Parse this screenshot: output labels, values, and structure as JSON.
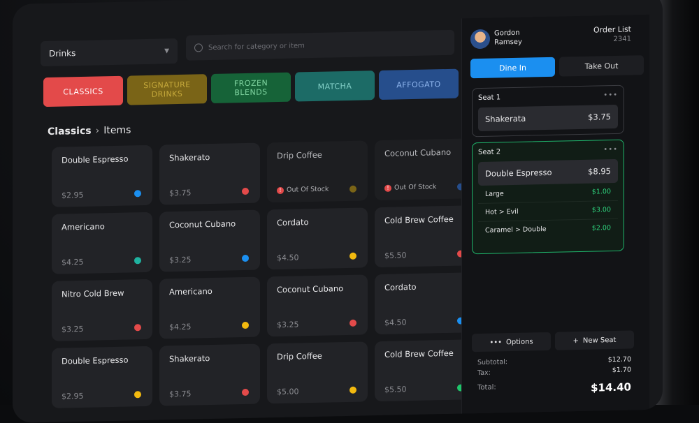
{
  "category_select": {
    "value": "Drinks"
  },
  "search": {
    "placeholder": "Search for category or item"
  },
  "tabs": [
    {
      "label": "CLASSICS"
    },
    {
      "label": "SIGNATURE DRINKS"
    },
    {
      "label": "FROZEN BLENDS"
    },
    {
      "label": "MATCHA"
    },
    {
      "label": "AFFOGATO"
    }
  ],
  "breadcrumb": {
    "current": "Classics",
    "sub": "Items"
  },
  "items": [
    {
      "name": "Double Espresso",
      "price": "$2.95",
      "dot": "#1b8ff0"
    },
    {
      "name": "Shakerato",
      "price": "$3.75",
      "dot": "#e34a4a"
    },
    {
      "name": "Drip Coffee",
      "status": "Out Of Stock",
      "dot": "#7a6417"
    },
    {
      "name": "Coconut Cubano",
      "status": "Out Of Stock",
      "dot": "#264e8c"
    },
    {
      "name": "Americano",
      "price": "$4.25",
      "dot": "#1fb2a0"
    },
    {
      "name": "Coconut Cubano",
      "price": "$3.25",
      "dot": "#1b8ff0"
    },
    {
      "name": "Cordato",
      "price": "$4.50",
      "dot": "#f2b90f"
    },
    {
      "name": "Cold Brew Coffee",
      "price": "$5.50",
      "dot": "#e34a4a"
    },
    {
      "name": "Nitro Cold Brew",
      "price": "$3.25",
      "dot": "#e34a4a"
    },
    {
      "name": "Americano",
      "price": "$4.25",
      "dot": "#f2b90f"
    },
    {
      "name": "Coconut Cubano",
      "price": "$3.25",
      "dot": "#e34a4a"
    },
    {
      "name": "Cordato",
      "price": "$4.50",
      "dot": "#1b8ff0"
    },
    {
      "name": "Double Espresso",
      "price": "$2.95",
      "dot": "#f2b90f"
    },
    {
      "name": "Shakerato",
      "price": "$3.75",
      "dot": "#e34a4a"
    },
    {
      "name": "Drip Coffee",
      "price": "$5.00",
      "dot": "#f2b90f"
    },
    {
      "name": "Cold Brew Coffee",
      "price": "$5.50",
      "dot": "#1fc46a"
    }
  ],
  "user": {
    "first": "Gordon",
    "last": "Ramsey"
  },
  "order": {
    "label": "Order List",
    "number": "2341"
  },
  "service": {
    "dine_in": "Dine In",
    "take_out": "Take Out"
  },
  "seat1": {
    "label": "Seat 1",
    "more": "•••",
    "item": "Shakerata",
    "price": "$3.75"
  },
  "seat2": {
    "label": "Seat 2",
    "more": "•••",
    "item": "Double Espresso",
    "price": "$8.95",
    "mods": [
      {
        "name": "Large",
        "price": "$1.00"
      },
      {
        "name": "Hot > Evil",
        "price": "$3.00"
      },
      {
        "name": "Caramel > Double",
        "price": "$2.00"
      }
    ]
  },
  "actions": {
    "options": "Options",
    "new_seat": "New Seat"
  },
  "totals": {
    "subtotal_label": "Subtotal:",
    "subtotal": "$12.70",
    "tax_label": "Tax:",
    "tax": "$1.70",
    "total_label": "Total:",
    "total": "$14.40"
  }
}
